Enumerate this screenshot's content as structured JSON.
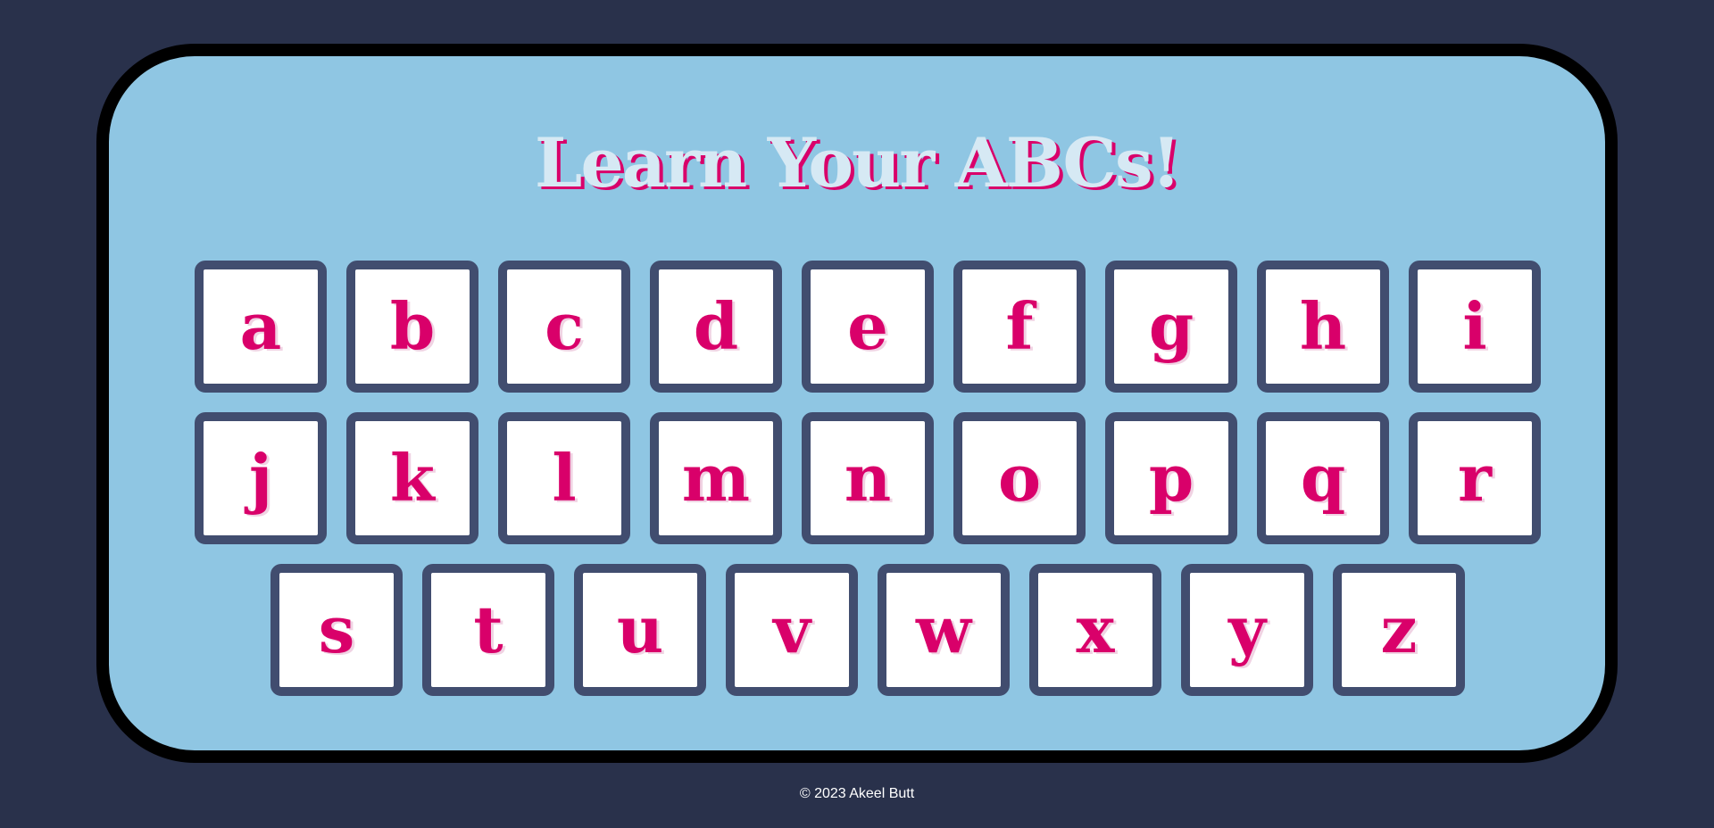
{
  "app": {
    "title": "Learn Your ABCs!",
    "footer": "© 2023 Akeel Butt"
  },
  "colors": {
    "page_background": "#29314b",
    "board_background": "#8fc6e3",
    "board_border": "#000000",
    "title_fill": "#d6e9f4",
    "accent": "#d9006a",
    "key_border": "#414d6f",
    "key_background": "#ffffff"
  },
  "keyboard": {
    "rows": [
      [
        "a",
        "b",
        "c",
        "d",
        "e",
        "f",
        "g",
        "h",
        "i"
      ],
      [
        "j",
        "k",
        "l",
        "m",
        "n",
        "o",
        "p",
        "q",
        "r"
      ],
      [
        "s",
        "t",
        "u",
        "v",
        "w",
        "x",
        "y",
        "z"
      ]
    ]
  }
}
